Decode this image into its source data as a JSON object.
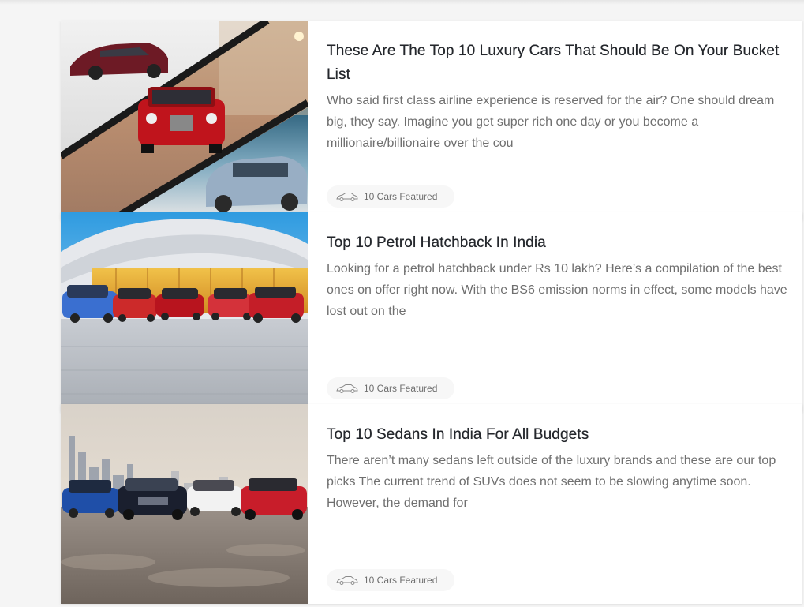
{
  "articles": [
    {
      "title": "These Are The Top 10 Luxury Cars That Should Be On Your Bucket List",
      "description": "Who said first class airline experience is reserved for the air? One should dream big, they say. Imagine you get super rich one day or you become a millionaire/billionaire over the cou",
      "badge": "10 Cars Featured",
      "badge_icon": "car-icon"
    },
    {
      "title": "Top 10 Petrol Hatchback In India",
      "description": "Looking for a petrol hatchback under Rs 10 lakh? Here’s a compilation of the best ones on offer right now. With the BS6 emission norms in effect, some models have lost out on the",
      "badge": "10 Cars Featured",
      "badge_icon": "car-icon"
    },
    {
      "title": "Top 10 Sedans In India For All Budgets",
      "description": "There aren’t many sedans left outside of the luxury brands and these are our top picks The current trend of SUVs does not seem to be slowing anytime soon. However, the demand for",
      "badge": "10 Cars Featured",
      "badge_icon": "car-icon"
    }
  ],
  "colors": {
    "page_background": "#f5f5f5",
    "card_background": "#ffffff",
    "title_text": "#24272c",
    "body_text": "#6f6f6f",
    "badge_background": "#f7f7f7"
  }
}
